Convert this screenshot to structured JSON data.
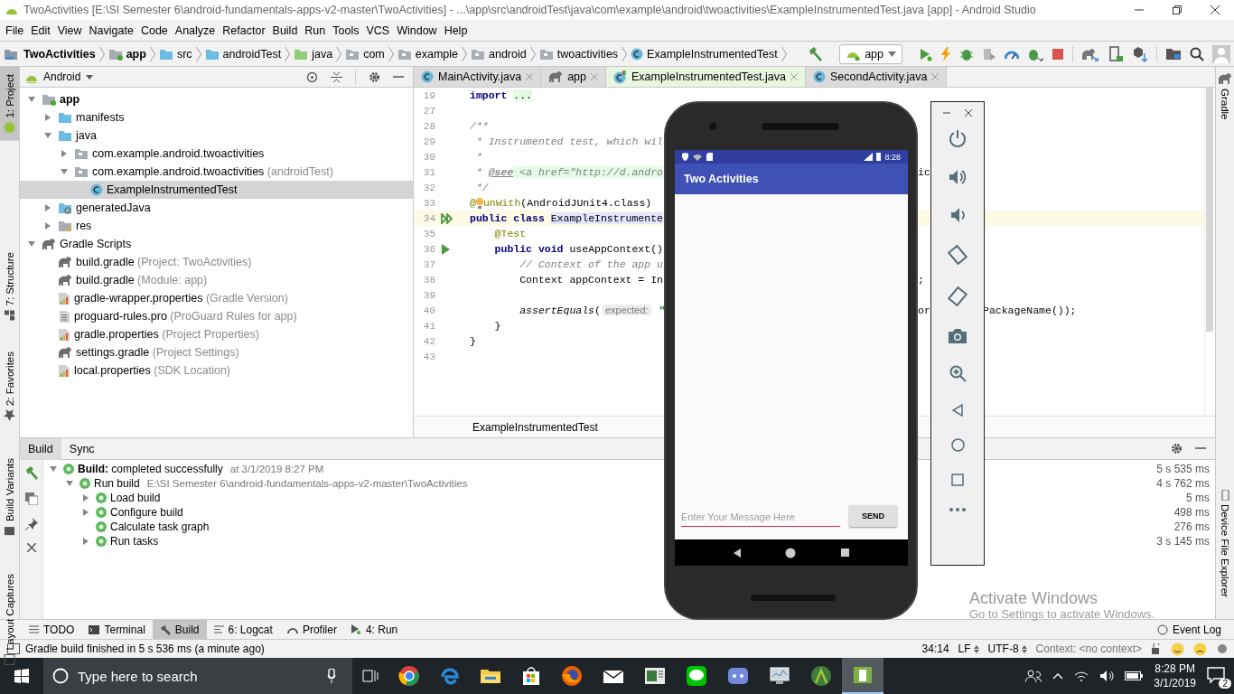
{
  "window": {
    "title": "TwoActivities [E:\\SI Semester 6\\android-fundamentals-apps-v2-master\\TwoActivities] - ...\\app\\src\\androidTest\\java\\com\\example\\android\\twoactivities\\ExampleInstrumentedTest.java [app] - Android Studio"
  },
  "menu": [
    "File",
    "Edit",
    "View",
    "Navigate",
    "Code",
    "Analyze",
    "Refactor",
    "Build",
    "Run",
    "Tools",
    "VCS",
    "Window",
    "Help"
  ],
  "breadcrumbs": [
    {
      "label": "TwoActivities",
      "kind": "project"
    },
    {
      "label": "app",
      "kind": "module"
    },
    {
      "label": "src",
      "kind": "folder"
    },
    {
      "label": "androidTest",
      "kind": "folder"
    },
    {
      "label": "java",
      "kind": "source"
    },
    {
      "label": "com",
      "kind": "package"
    },
    {
      "label": "example",
      "kind": "package"
    },
    {
      "label": "android",
      "kind": "package"
    },
    {
      "label": "twoactivities",
      "kind": "package"
    },
    {
      "label": "ExampleInstrumentedTest",
      "kind": "class"
    }
  ],
  "run_configuration": "app",
  "left_tool_tabs": [
    {
      "label": "1: Project",
      "selected": true
    },
    {
      "label": "7: Structure",
      "selected": false
    },
    {
      "label": "2: Favorites",
      "selected": false
    },
    {
      "label": "Build Variants",
      "selected": false
    },
    {
      "label": "Layout Captures",
      "selected": false
    }
  ],
  "right_tool_tabs": [
    "Gradle",
    "Device File Explorer"
  ],
  "project_panel": {
    "view": "Android",
    "tree": [
      {
        "label": "app",
        "kind": "module",
        "expanded": true,
        "selected": false,
        "children": [
          {
            "label": "manifests",
            "kind": "folder",
            "expanded": false,
            "selected": false
          },
          {
            "label": "java",
            "kind": "folder",
            "expanded": true,
            "selected": false,
            "children": [
              {
                "label": "com.example.android.twoactivities",
                "kind": "package",
                "expanded": false,
                "selected": false
              },
              {
                "label": "com.example.android.twoactivities",
                "note": "(androidTest)",
                "kind": "package",
                "expanded": true,
                "selected": false,
                "children": [
                  {
                    "label": "ExampleInstrumentedTest",
                    "kind": "class",
                    "selected": true
                  }
                ]
              }
            ]
          },
          {
            "label": "generatedJava",
            "kind": "generated",
            "expanded": false,
            "selected": false
          },
          {
            "label": "res",
            "kind": "resources",
            "expanded": false,
            "selected": false
          }
        ]
      },
      {
        "label": "Gradle Scripts",
        "kind": "gradle",
        "expanded": true,
        "selected": false,
        "children": [
          {
            "label": "build.gradle",
            "note": "(Project: TwoActivities)",
            "kind": "gradle",
            "selected": false
          },
          {
            "label": "build.gradle",
            "note": "(Module: app)",
            "kind": "gradle",
            "selected": false
          },
          {
            "label": "gradle-wrapper.properties",
            "note": "(Gradle Version)",
            "kind": "properties",
            "selected": false
          },
          {
            "label": "proguard-rules.pro",
            "note": "(ProGuard Rules for app)",
            "kind": "text",
            "selected": false
          },
          {
            "label": "gradle.properties",
            "note": "(Project Properties)",
            "kind": "properties",
            "selected": false
          },
          {
            "label": "settings.gradle",
            "note": "(Project Settings)",
            "kind": "gradle",
            "selected": false
          },
          {
            "label": "local.properties",
            "note": "(SDK Location)",
            "kind": "properties",
            "selected": false
          }
        ]
      }
    ]
  },
  "editor": {
    "tabs": [
      {
        "label": "MainActivity.java",
        "kind": "class",
        "selected": false
      },
      {
        "label": "app",
        "kind": "gradle",
        "selected": false
      },
      {
        "label": "ExampleInstrumentedTest.java",
        "kind": "test_class",
        "selected": true
      },
      {
        "label": "SecondActivity.java",
        "kind": "class",
        "selected": false
      }
    ],
    "lines": [
      {
        "number": "19",
        "current": false,
        "code": [
          {
            "kind": "keyword",
            "text": "import "
          },
          {
            "kind": "folded",
            "text": "..."
          }
        ]
      },
      {
        "number": "27",
        "current": false
      },
      {
        "number": "28",
        "current": false,
        "code": [
          {
            "kind": "comment",
            "text": "/**"
          }
        ]
      },
      {
        "number": "29",
        "current": false,
        "code": [
          {
            "kind": "comment",
            "text": " * Instrumented test, which wil"
          }
        ]
      },
      {
        "number": "30",
        "current": false,
        "code": [
          {
            "kind": "comment",
            "text": " *"
          }
        ]
      },
      {
        "number": "31",
        "current": false,
        "code": [
          {
            "kind": "comment",
            "text": " * "
          },
          {
            "kind": "doc_tag",
            "text": "@see"
          },
          {
            "kind": "html",
            "text": " <a href=\"http://d.andro"
          }
        ],
        "tail": "ic"
      },
      {
        "number": "32",
        "current": false,
        "code": [
          {
            "kind": "comment",
            "text": " */"
          }
        ]
      },
      {
        "number": "33",
        "current": false,
        "code": [
          {
            "kind": "annotation",
            "text": "@"
          },
          {
            "kind": "bulb"
          },
          {
            "kind": "annotation",
            "text": "unWith"
          },
          {
            "kind": "plain",
            "text": "(AndroidJUnit4.class)"
          }
        ]
      },
      {
        "number": "34",
        "current": true,
        "marker": {
          "kind": "run_all"
        },
        "code": [
          {
            "kind": "keyword",
            "text": "public class "
          },
          {
            "kind": "declaration",
            "text": "ExampleInstrumente"
          }
        ]
      },
      {
        "number": "35",
        "current": false,
        "code": [
          {
            "kind": "annotation",
            "text": "    @Test"
          }
        ]
      },
      {
        "number": "36",
        "current": false,
        "marker": {
          "kind": "run_single"
        },
        "code": [
          {
            "kind": "keyword",
            "text": "    public void"
          },
          {
            "kind": "plain",
            "text": " useAppContext()"
          }
        ]
      },
      {
        "number": "37",
        "current": false,
        "code": [
          {
            "kind": "comment",
            "text": "        // Context of the app u"
          }
        ]
      },
      {
        "number": "38",
        "current": false,
        "code": [
          {
            "kind": "plain",
            "text": "        Context appContext = In"
          }
        ],
        "tail": ";"
      },
      {
        "number": "39",
        "current": false
      },
      {
        "number": "40",
        "current": false,
        "code": [
          {
            "kind": "call",
            "text": "        assertEquals"
          },
          {
            "kind": "plain",
            "text": "("
          },
          {
            "kind": "hint",
            "text": "expected:"
          },
          {
            "kind": "string",
            "text": " \""
          }
        ],
        "tail": "or",
        "far": "PackageName());"
      },
      {
        "number": "41",
        "current": false,
        "code": [
          {
            "kind": "plain",
            "text": "    }"
          }
        ]
      },
      {
        "number": "42",
        "current": false,
        "code": [
          {
            "kind": "plain",
            "text": "}"
          }
        ]
      },
      {
        "number": "43",
        "current": false
      }
    ],
    "breadcrumb": "ExampleInstrumentedTest"
  },
  "build_panel": {
    "tabs": [
      {
        "label": "Build",
        "selected": true
      },
      {
        "label": "Sync",
        "selected": false
      }
    ],
    "tree": [
      {
        "label": "**Build:** completed successfully",
        "note": "at 3/1/2019 8:27 PM",
        "duration": "5 s 535 ms",
        "expanded": true,
        "children": [
          {
            "label": "Run build",
            "note": "E:\\SI Semester 6\\android-fundamentals-apps-v2-master\\TwoActivities",
            "duration": "4 s 762 ms",
            "expanded": true,
            "children": [
              {
                "label": "Load build",
                "duration": "5 ms",
                "expanded": false
              },
              {
                "label": "Configure build",
                "duration": "498 ms",
                "expanded": false
              },
              {
                "label": "Calculate task graph",
                "duration": "276 ms"
              },
              {
                "label": "Run tasks",
                "duration": "3 s 145 ms",
                "expanded": false
              }
            ]
          }
        ]
      }
    ]
  },
  "tool_windows": [
    {
      "label": "TODO",
      "selected": false
    },
    {
      "label": "Terminal",
      "selected": false
    },
    {
      "label": "Build",
      "selected": true
    },
    {
      "label": "6: Logcat",
      "selected": false
    },
    {
      "label": "Profiler",
      "selected": false
    },
    {
      "label": "4: Run",
      "selected": false
    }
  ],
  "event_log": "Event Log",
  "status_bar": {
    "message": "Gradle build finished in 5 s 536 ms (a minute ago)",
    "position": "34:14",
    "line_separator": "LF",
    "encoding": "UTF-8",
    "context": "Context: <no context>"
  },
  "emulator": {
    "status_time": "8:28",
    "app_title": "Two Activities",
    "message_field": {
      "placeholder": "Enter Your Message Here"
    },
    "send_button": "SEND"
  },
  "windows_notice": {
    "title": "Activate Windows",
    "message": "Go to Settings to activate Windows."
  },
  "taskbar": {
    "search_placeholder": "Type here to search",
    "time": "8:28 PM",
    "date": "3/1/2019",
    "notifications": "2"
  }
}
